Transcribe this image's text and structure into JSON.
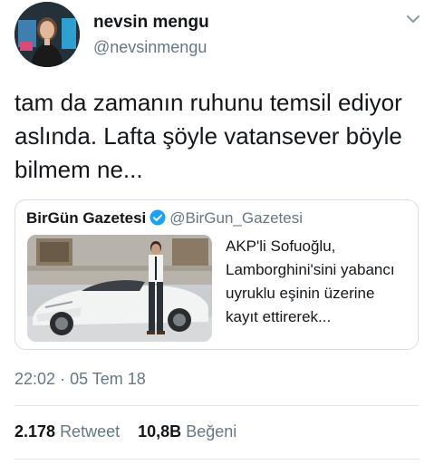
{
  "author": {
    "name": "nevsin mengu",
    "handle": "@nevsinmengu",
    "avatar_icon": "avatar-photo"
  },
  "menu_icon": "chevron-down-icon",
  "tweet": {
    "text": "tam da zamanın ruhunu temsil ediyor aslında. Lafta şöyle vatansever böyle bilmem ne..."
  },
  "quoted_tweet": {
    "name": "BirGün Gazetesi",
    "verified_icon": "verified-badge-icon",
    "handle": "@BirGun_Gazetesi",
    "text": "AKP'li Sofuoğlu, Lamborghini'sini yabancı uyruklu eşinin üzerine kayıt ettirerek...",
    "image": "photo-man-with-white-sports-car"
  },
  "timestamp": {
    "time": "22:02",
    "separator": "·",
    "date": "05 Tem 18"
  },
  "stats": {
    "retweet_count": "2.178",
    "retweet_label": "Retweet",
    "like_count": "10,8B",
    "like_label": "Beğeni"
  },
  "colors": {
    "text": "#14171a",
    "secondary": "#657786",
    "verified": "#1da1f2",
    "border": "#e1e8ed"
  }
}
